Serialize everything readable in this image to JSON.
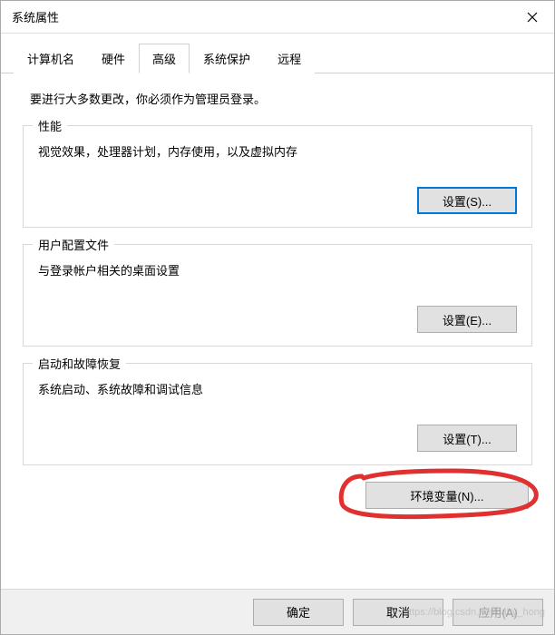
{
  "window": {
    "title": "系统属性"
  },
  "tabs": {
    "items": [
      {
        "label": "计算机名"
      },
      {
        "label": "硬件"
      },
      {
        "label": "高级"
      },
      {
        "label": "系统保护"
      },
      {
        "label": "远程"
      }
    ],
    "active_index": 2
  },
  "advanced": {
    "intro": "要进行大多数更改，你必须作为管理员登录。",
    "performance": {
      "title": "性能",
      "desc": "视觉效果，处理器计划，内存使用，以及虚拟内存",
      "button": "设置(S)..."
    },
    "user_profiles": {
      "title": "用户配置文件",
      "desc": "与登录帐户相关的桌面设置",
      "button": "设置(E)..."
    },
    "startup": {
      "title": "启动和故障恢复",
      "desc": "系统启动、系统故障和调试信息",
      "button": "设置(T)..."
    },
    "env_button": "环境变量(N)..."
  },
  "footer": {
    "ok": "确定",
    "cancel": "取消",
    "apply": "应用(A)"
  },
  "watermark": "https://blog.csdn.net/baby_hong"
}
